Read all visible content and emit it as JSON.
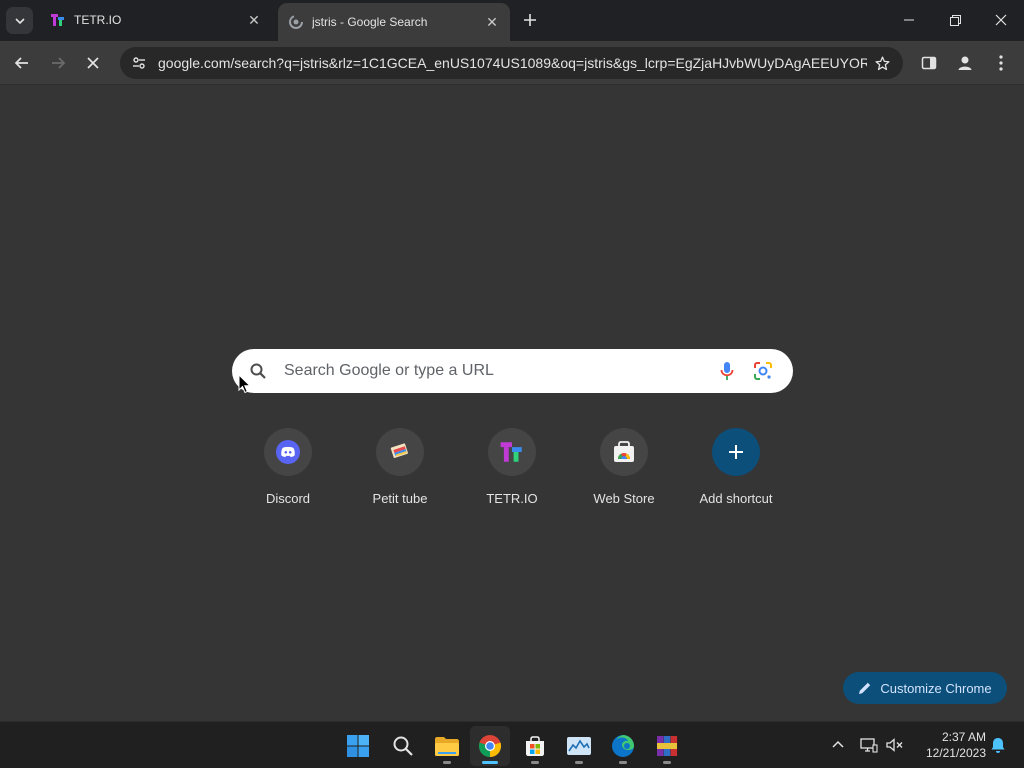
{
  "browser": {
    "tabs": [
      {
        "title": "TETR.IO",
        "favicon": "tetrio-icon",
        "active": false
      },
      {
        "title": "jstris - Google Search",
        "favicon": "loading-spinner-icon",
        "active": true
      }
    ],
    "address_bar": {
      "url": "google.com/search?q=jstris&rlz=1C1GCEA_enUS1074US1089&oq=jstris&gs_lcrp=EgZjaHJvbWUyDAgAEEUYORi..."
    }
  },
  "new_tab_page": {
    "search_placeholder": "Search Google or type a URL",
    "shortcuts": [
      {
        "label": "Discord",
        "icon": "discord-icon"
      },
      {
        "label": "Petit tube",
        "icon": "petit-tube-icon"
      },
      {
        "label": "TETR.IO",
        "icon": "tetrio-icon"
      },
      {
        "label": "Web Store",
        "icon": "web-store-icon"
      },
      {
        "label": "Add shortcut",
        "icon": "plus-icon"
      }
    ],
    "customize_label": "Customize Chrome"
  },
  "taskbar": {
    "apps": [
      "start-icon",
      "search-icon",
      "file-explorer-icon",
      "chrome-icon",
      "microsoft-store-icon",
      "task-manager-icon",
      "edge-icon",
      "winrar-icon"
    ],
    "time": "2:37 AM",
    "date": "12/21/2023"
  },
  "colors": {
    "page_background": "#353535",
    "accent": "#0b4f7a",
    "taskbar_active": "#4cc2ff"
  }
}
